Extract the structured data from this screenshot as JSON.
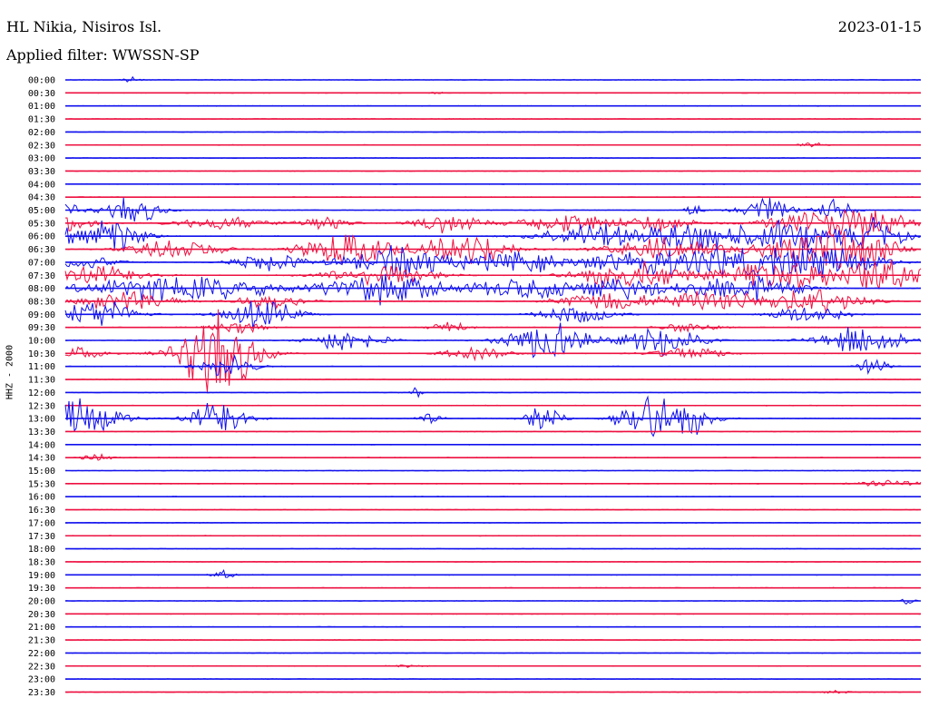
{
  "header": {
    "station": "HL Nikia, Nisiros Isl.",
    "date": "2023-01-15",
    "filter": "Applied filter: WWSSN-SP"
  },
  "channel_label": "HHZ - 2000",
  "colors": {
    "trace_even": "#1010ee",
    "trace_odd": "#ee1040"
  },
  "chart_data": {
    "type": "line",
    "title": "HL Nikia, Nisiros Isl.",
    "subtitle": "Applied filter: WWSSN-SP",
    "ylabel": "HHZ - 2000",
    "xlabel": "",
    "row_labels": [
      "00:00",
      "00:30",
      "01:00",
      "01:30",
      "02:00",
      "02:30",
      "03:00",
      "03:30",
      "04:00",
      "04:30",
      "05:00",
      "05:30",
      "06:00",
      "06:30",
      "07:00",
      "07:30",
      "08:00",
      "08:30",
      "09:00",
      "09:30",
      "10:00",
      "10:30",
      "11:00",
      "11:30",
      "12:00",
      "12:30",
      "13:00",
      "13:30",
      "14:00",
      "14:30",
      "15:00",
      "15:30",
      "16:00",
      "16:30",
      "17:00",
      "17:30",
      "18:00",
      "18:30",
      "19:00",
      "19:30",
      "20:00",
      "20:30",
      "21:00",
      "21:30",
      "22:00",
      "22:30",
      "23:00",
      "23:30"
    ],
    "x_unit": "fraction of 30-minute row",
    "y_unit": "relative amplitude (row spacings)",
    "series_colors_alternate": [
      "blue",
      "red"
    ],
    "bursts": [
      [
        0,
        0.075,
        0.01,
        0.3
      ],
      [
        1,
        0.435,
        0.005,
        0.15
      ],
      [
        5,
        0.872,
        0.012,
        0.25
      ],
      [
        10,
        0.0,
        0.02,
        0.6
      ],
      [
        10,
        0.08,
        0.03,
        1.2
      ],
      [
        10,
        0.735,
        0.01,
        0.7
      ],
      [
        10,
        0.82,
        0.03,
        1.1
      ],
      [
        10,
        0.9,
        0.02,
        0.9
      ],
      [
        11,
        0.0,
        0.03,
        0.7
      ],
      [
        11,
        0.18,
        0.05,
        0.55
      ],
      [
        11,
        0.3,
        0.03,
        0.7
      ],
      [
        11,
        0.45,
        0.04,
        0.8
      ],
      [
        11,
        0.59,
        0.05,
        0.9
      ],
      [
        11,
        0.695,
        0.04,
        0.7
      ],
      [
        11,
        0.88,
        0.06,
        1.0
      ],
      [
        11,
        0.95,
        0.04,
        0.9
      ],
      [
        12,
        0.0,
        0.015,
        0.8
      ],
      [
        12,
        0.055,
        0.035,
        1.6
      ],
      [
        12,
        0.62,
        0.06,
        1.2
      ],
      [
        12,
        0.74,
        0.05,
        1.4
      ],
      [
        12,
        0.85,
        0.06,
        1.3
      ],
      [
        12,
        0.95,
        0.03,
        1.4
      ],
      [
        13,
        0.13,
        0.05,
        0.9
      ],
      [
        13,
        0.33,
        0.05,
        1.5
      ],
      [
        13,
        0.47,
        0.05,
        1.4
      ],
      [
        13,
        0.7,
        0.06,
        1.0
      ],
      [
        13,
        0.86,
        0.05,
        1.6
      ],
      [
        13,
        0.93,
        0.04,
        1.7
      ],
      [
        14,
        0.02,
        0.04,
        0.6
      ],
      [
        14,
        0.24,
        0.04,
        0.8
      ],
      [
        14,
        0.39,
        0.06,
        1.4
      ],
      [
        14,
        0.53,
        0.06,
        0.9
      ],
      [
        14,
        0.68,
        0.06,
        1.3
      ],
      [
        14,
        0.79,
        0.06,
        1.2
      ],
      [
        14,
        0.89,
        0.06,
        1.3
      ],
      [
        15,
        0.04,
        0.05,
        0.8
      ],
      [
        15,
        0.37,
        0.06,
        0.9
      ],
      [
        15,
        0.66,
        0.06,
        1.3
      ],
      [
        15,
        0.83,
        0.06,
        1.4
      ],
      [
        15,
        0.95,
        0.05,
        1.6
      ],
      [
        16,
        0.08,
        0.07,
        0.8
      ],
      [
        16,
        0.18,
        0.07,
        0.9
      ],
      [
        16,
        0.37,
        0.07,
        1.3
      ],
      [
        16,
        0.53,
        0.05,
        0.9
      ],
      [
        16,
        0.64,
        0.06,
        1.0
      ],
      [
        16,
        0.79,
        0.06,
        1.3
      ],
      [
        17,
        0.07,
        0.05,
        1.0
      ],
      [
        17,
        0.24,
        0.04,
        0.6
      ],
      [
        17,
        0.63,
        0.05,
        0.8
      ],
      [
        17,
        0.76,
        0.06,
        1.0
      ],
      [
        17,
        0.88,
        0.05,
        1.1
      ],
      [
        18,
        0.04,
        0.04,
        1.4
      ],
      [
        18,
        0.23,
        0.04,
        1.3
      ],
      [
        18,
        0.6,
        0.04,
        0.8
      ],
      [
        18,
        0.87,
        0.04,
        0.8
      ],
      [
        19,
        0.2,
        0.03,
        0.6
      ],
      [
        19,
        0.45,
        0.02,
        0.5
      ],
      [
        19,
        0.73,
        0.03,
        0.5
      ],
      [
        20,
        0.33,
        0.04,
        1.0
      ],
      [
        20,
        0.55,
        0.04,
        1.0
      ],
      [
        20,
        0.58,
        0.04,
        1.0
      ],
      [
        20,
        0.7,
        0.04,
        1.5
      ],
      [
        20,
        0.93,
        0.05,
        1.2
      ],
      [
        21,
        0.01,
        0.04,
        0.5
      ],
      [
        21,
        0.17,
        0.04,
        2.2
      ],
      [
        21,
        0.19,
        0.04,
        1.8
      ],
      [
        21,
        0.48,
        0.04,
        0.5
      ],
      [
        21,
        0.73,
        0.04,
        0.6
      ],
      [
        22,
        0.19,
        0.03,
        1.0
      ],
      [
        22,
        0.945,
        0.015,
        0.9
      ],
      [
        24,
        0.41,
        0.005,
        0.9
      ],
      [
        26,
        0.01,
        0.05,
        1.8
      ],
      [
        26,
        0.18,
        0.03,
        1.6
      ],
      [
        26,
        0.43,
        0.015,
        0.5
      ],
      [
        26,
        0.56,
        0.02,
        1.3
      ],
      [
        26,
        0.68,
        0.03,
        2.5
      ],
      [
        26,
        0.73,
        0.03,
        1.3
      ],
      [
        29,
        0.035,
        0.015,
        0.4
      ],
      [
        31,
        0.97,
        0.04,
        0.3
      ],
      [
        38,
        0.185,
        0.012,
        0.4
      ],
      [
        40,
        0.985,
        0.006,
        0.5
      ],
      [
        45,
        0.4,
        0.02,
        0.1
      ],
      [
        47,
        0.905,
        0.015,
        0.15
      ]
    ]
  }
}
